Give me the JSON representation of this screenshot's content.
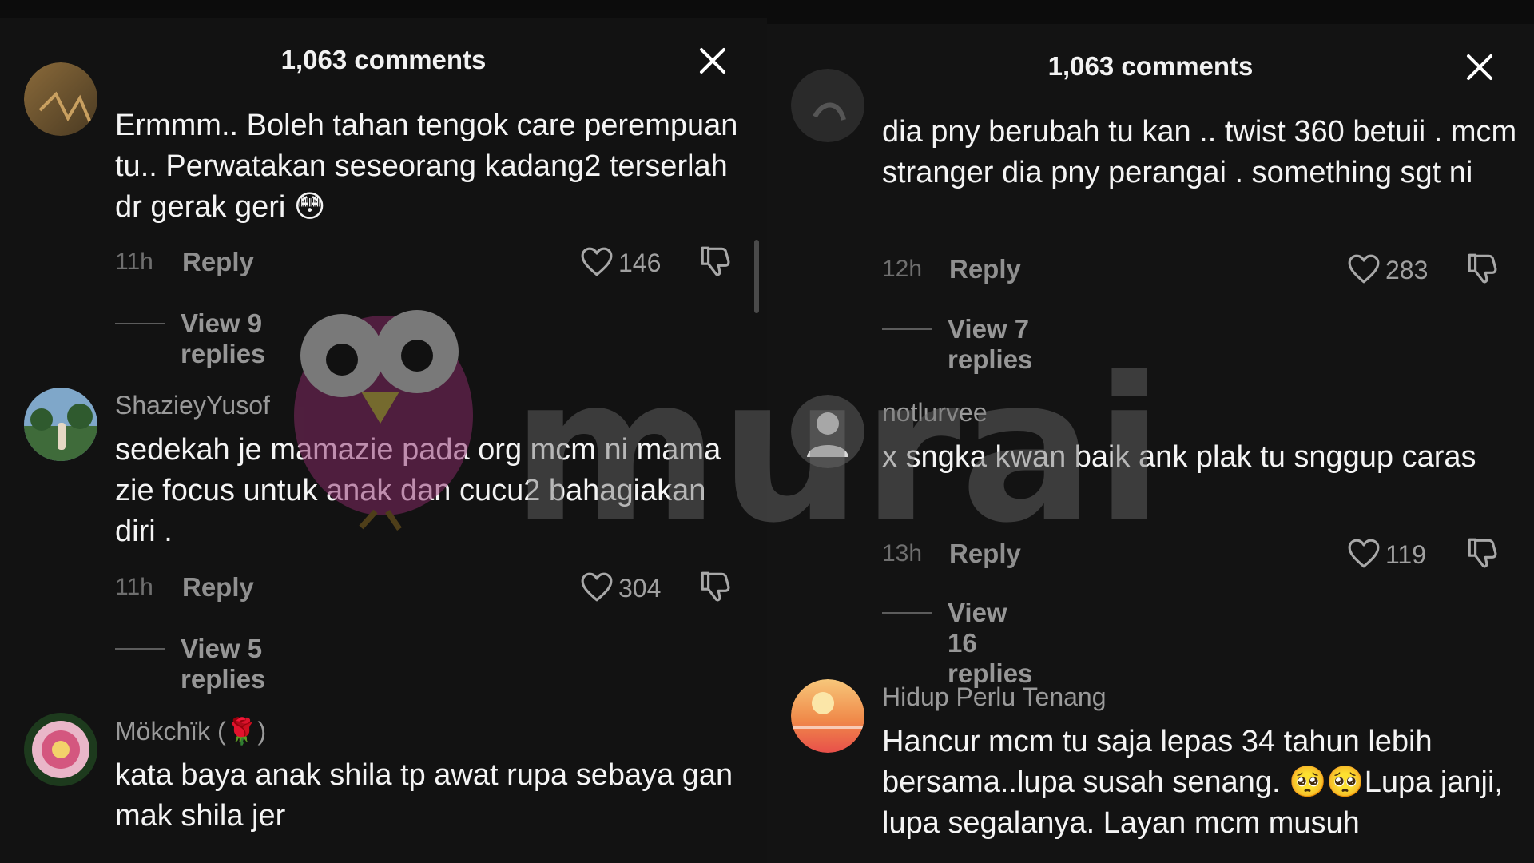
{
  "colors": {
    "background": "#121212",
    "text": "#f4f4f4",
    "muted": "#9a9a9a",
    "watermark": "#8c2b6a"
  },
  "watermark": {
    "text": "murai"
  },
  "left_panel": {
    "title": "1,063 comments",
    "comments": [
      {
        "username": "",
        "text": "Ermmm.. Boleh tahan tengok care perempuan tu.. Perwatakan seseorang kadang2 terserlah dr gerak geri 😳",
        "time": "11h",
        "reply_label": "Reply",
        "likes": "146",
        "view_replies": "View 9 replies",
        "avatar": "photo-avatar"
      },
      {
        "username": "ShazieyYusof",
        "text": "sedekah je mamazie pada org mcm ni mama zie focus untuk anak dan cucu2 bahagiakan diri .",
        "time": "11h",
        "reply_label": "Reply",
        "likes": "304",
        "view_replies": "View 5 replies",
        "avatar": "landscape-avatar"
      },
      {
        "username": "Mökchïk (🌹)",
        "text": "kata baya anak shila tp awat rupa sebaya gan mak shila jer",
        "avatar": "flower-avatar"
      }
    ]
  },
  "right_panel": {
    "title": "1,063 comments",
    "comments": [
      {
        "username": "",
        "text": "dia pny berubah tu kan .. twist 360 betuii . mcm stranger dia pny perangai . something sgt ni",
        "time": "12h",
        "reply_label": "Reply",
        "likes": "283",
        "view_replies": "View 7 replies",
        "avatar": "dark-photo-avatar"
      },
      {
        "username": "notlurvee",
        "text": "x sngka kwan baik ank plak tu snggup caras",
        "time": "13h",
        "reply_label": "Reply",
        "likes": "119",
        "view_replies": "View 16 replies",
        "avatar": "default-user-avatar"
      },
      {
        "username": "Hidup Perlu Tenang",
        "text": "Hancur mcm tu saja lepas 34 tahun lebih bersama..lupa susah senang. 🥺🥺Lupa janji, lupa segalanya. Layan mcm musuh",
        "avatar": "sunset-avatar"
      }
    ]
  }
}
